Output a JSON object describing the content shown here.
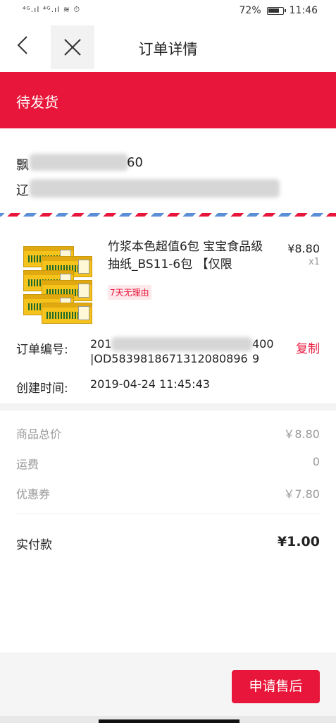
{
  "status_bar": {
    "signal": "⁴ᴳ.ıl ⁴ᴳ.ıl ≋ ⏱",
    "battery": "72%",
    "battery_level": 0.72,
    "time": "11:46"
  },
  "nav": {
    "back_icon": "chevron-left-icon",
    "close_icon": "close-icon",
    "title": "订单详情"
  },
  "order_status": "待发货",
  "address": {
    "name_prefix": "飘",
    "name_suffix": "60",
    "line_prefix": "辽"
  },
  "product": {
    "title": "竹浆本色超值6包 宝宝食品级抽纸_BS11-6包 【仅限",
    "price": "¥8.80",
    "quantity": "x1",
    "badge": "7天无理由",
    "image": "tissue-pack-image"
  },
  "order_info": {
    "order_no_label": "订单编号:",
    "order_no_line1": "201",
    "order_no_line1_end": "4009",
    "order_no_line2": "|OD5839818671312080896",
    "copy_label": "复制",
    "created_label": "创建时间:",
    "created_value": "2019-04-24 11:45:43"
  },
  "summary": {
    "items": [
      {
        "label": "商品总价",
        "value": "￥8.80"
      },
      {
        "label": "运费",
        "value": "0"
      },
      {
        "label": "优惠券",
        "value": "￥7.80"
      }
    ],
    "total_label": "实付款",
    "total_value": "¥1.00"
  },
  "actions": {
    "after_sale": "申请售后"
  },
  "colors": {
    "accent": "#e8163a",
    "text": "#222222",
    "muted": "#999999"
  }
}
